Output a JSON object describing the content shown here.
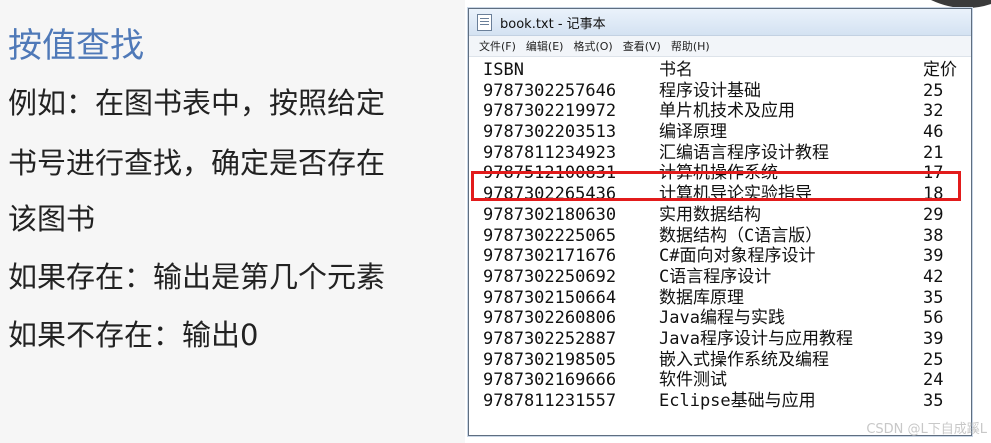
{
  "slide": {
    "title": "按值查找",
    "lines": [
      "例如：在图书表中，按照给定",
      "书号进行查找，确定是否存在",
      "该图书",
      "如果存在：输出是第几个元素",
      "如果不存在：输出0"
    ]
  },
  "window": {
    "title": "book.txt - 记事本",
    "menu": [
      "文件(F)",
      "编辑(E)",
      "格式(O)",
      "查看(V)",
      "帮助(H)"
    ]
  },
  "table": {
    "headers": [
      "ISBN",
      "书名",
      "定价"
    ],
    "rows": [
      [
        "9787302257646",
        "程序设计基础",
        "25"
      ],
      [
        "9787302219972",
        "单片机技术及应用",
        "32"
      ],
      [
        "9787302203513",
        "编译原理",
        "46"
      ],
      [
        "9787811234923",
        "汇编语言程序设计教程",
        "21"
      ],
      [
        "9787512100831",
        "计算机操作系统",
        "17"
      ],
      [
        "9787302265436",
        "计算机导论实验指导",
        "18"
      ],
      [
        "9787302180630",
        "实用数据结构",
        "29"
      ],
      [
        "9787302225065",
        "数据结构（C语言版）",
        "38"
      ],
      [
        "9787302171676",
        "C#面向对象程序设计",
        "39"
      ],
      [
        "9787302250692",
        "C语言程序设计",
        "42"
      ],
      [
        "9787302150664",
        "数据库原理",
        "35"
      ],
      [
        "9787302260806",
        "Java编程与实践",
        "56"
      ],
      [
        "9787302252887",
        "Java程序设计与应用教程",
        "39"
      ],
      [
        "9787302198505",
        "嵌入式操作系统及编程",
        "25"
      ],
      [
        "9787302169666",
        "软件测试",
        "24"
      ],
      [
        "9787811231557",
        "Eclipse基础与应用",
        "35"
      ]
    ],
    "highlighted_row": 2,
    "highlight_color": "#e21b1b"
  },
  "watermark": "CSDN @L下自成蹊L"
}
